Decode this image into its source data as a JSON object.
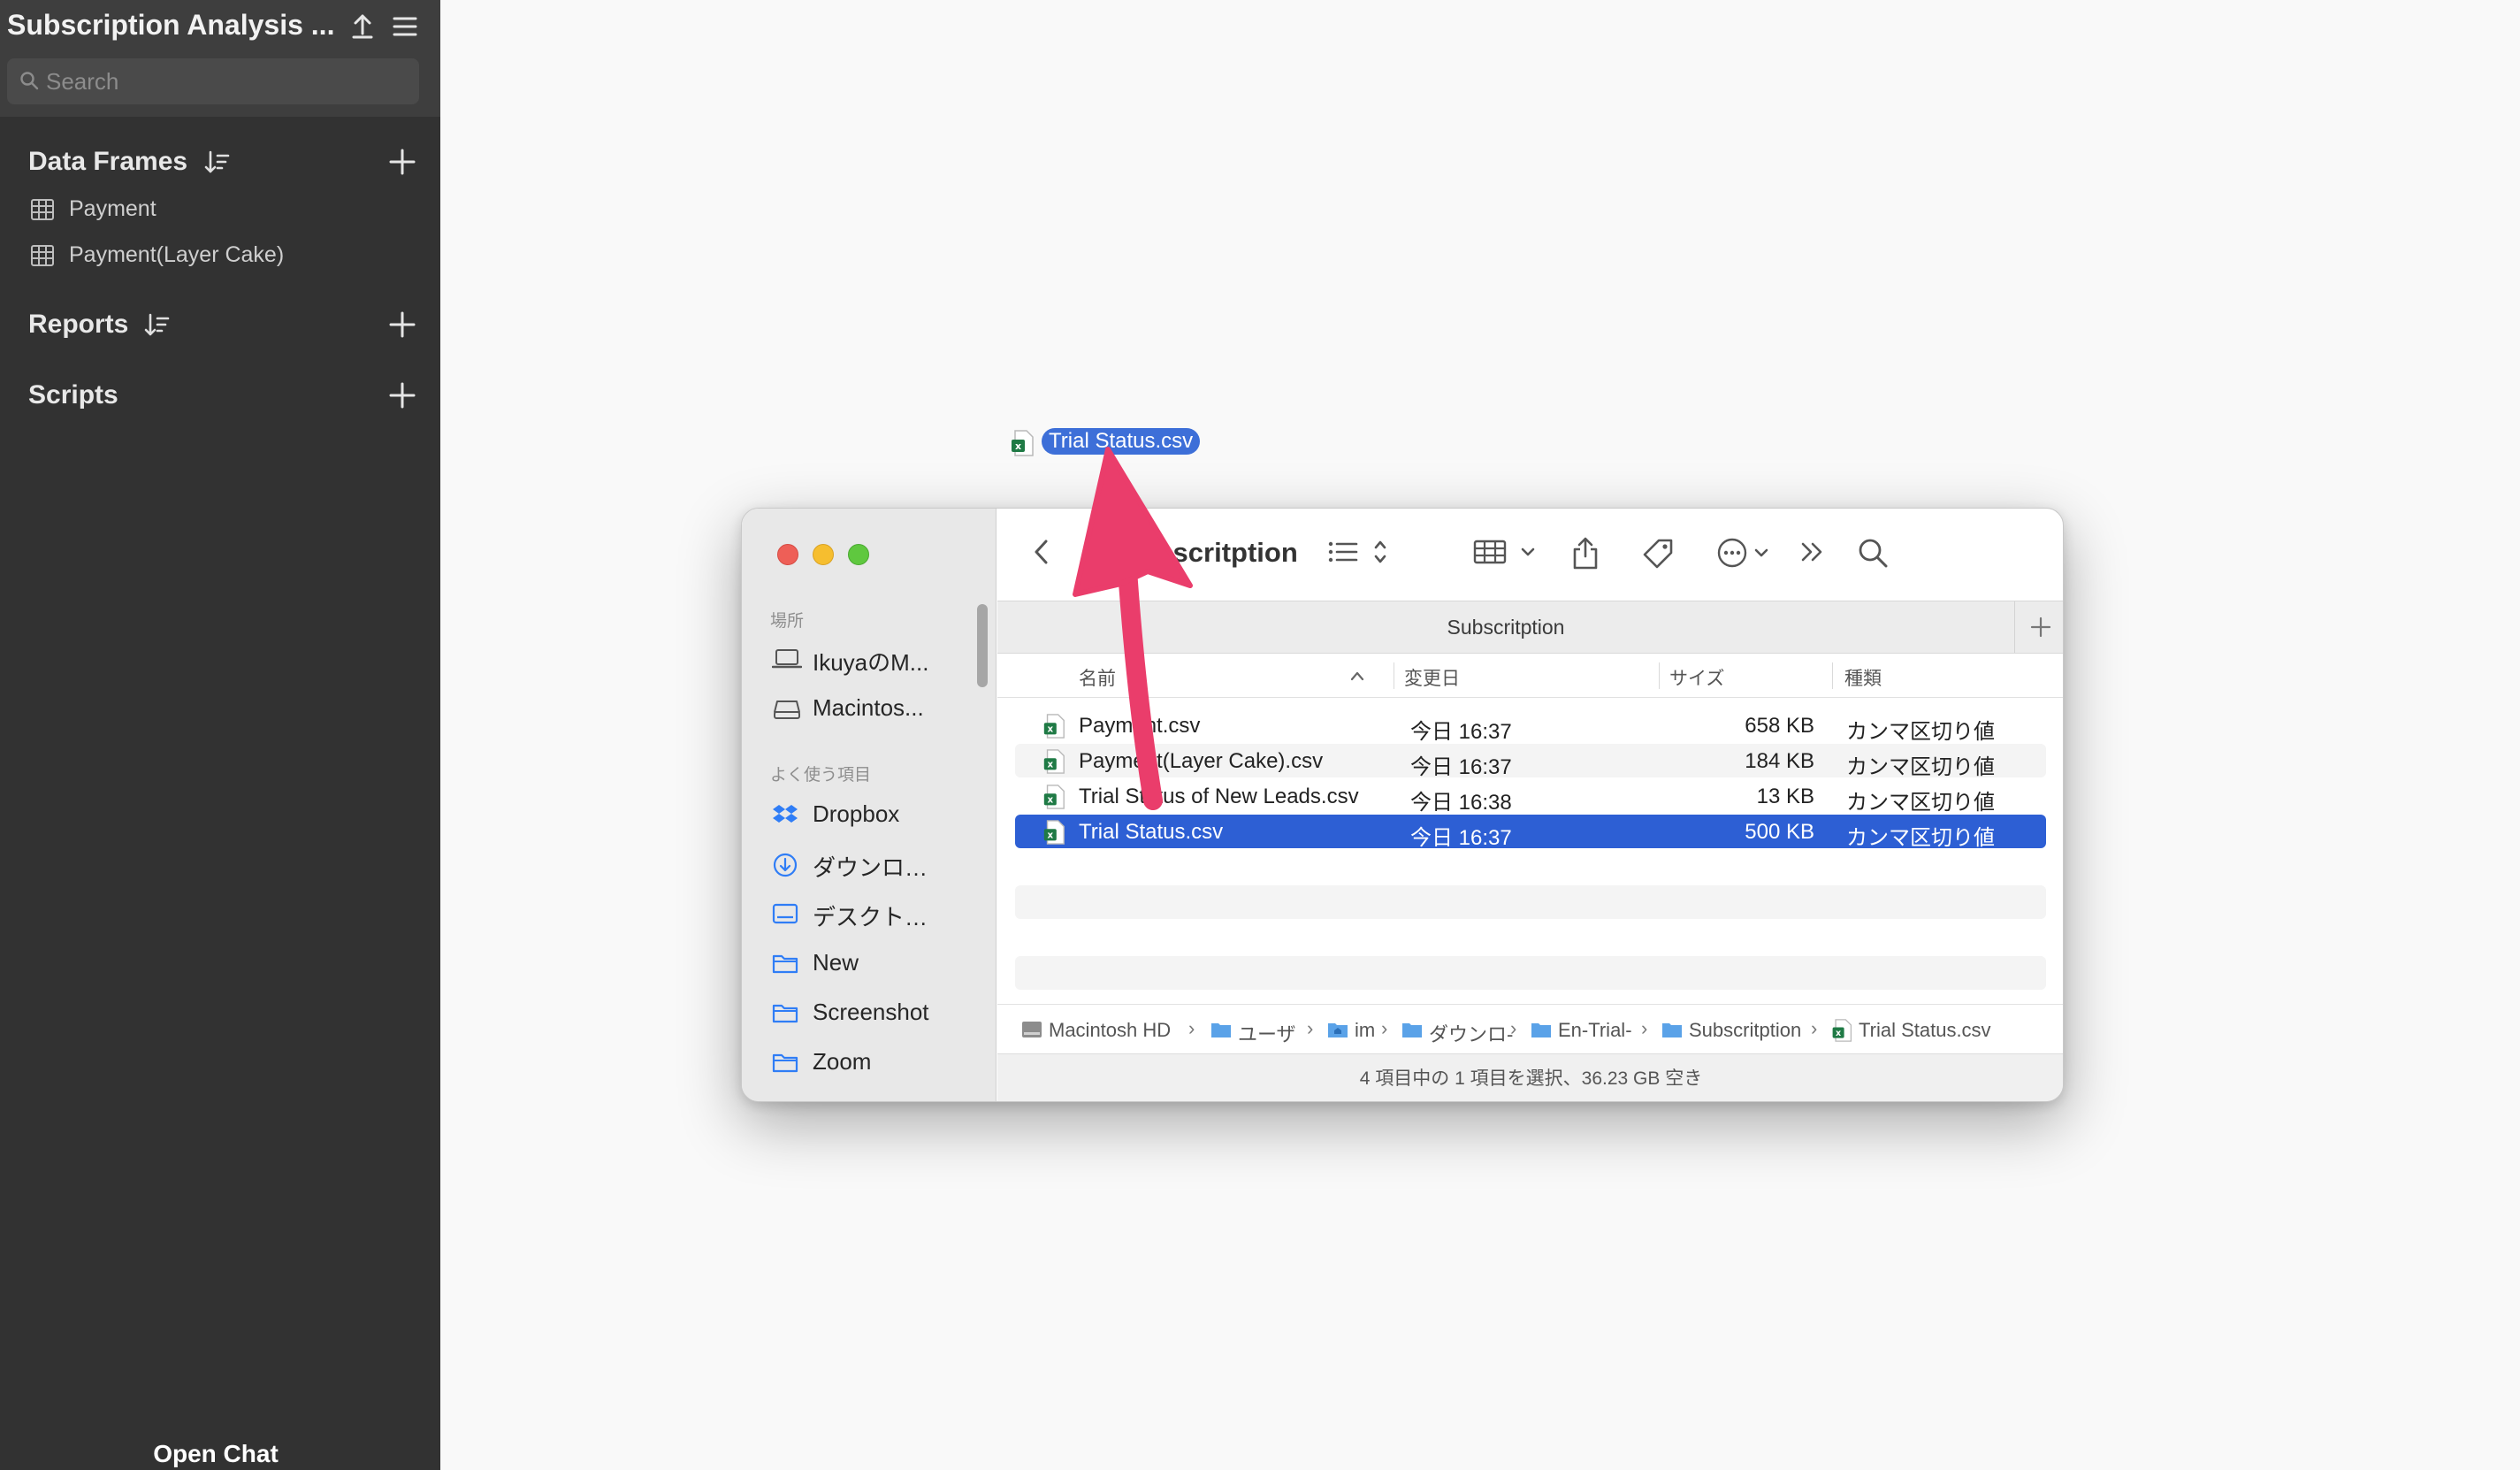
{
  "app": {
    "title": "Subscription Analysis ...",
    "search_placeholder": "Search",
    "sections": {
      "data_frames": "Data Frames",
      "reports": "Reports",
      "scripts": "Scripts"
    },
    "data_frames": [
      {
        "label": "Payment"
      },
      {
        "label": "Payment(Layer Cake)"
      }
    ],
    "open_chat": "Open Chat"
  },
  "drag": {
    "filename": "Trial Status.csv"
  },
  "finder": {
    "title": "Subscritption",
    "tab_label": "Subscritption",
    "sidebar": {
      "group_locations": "場所",
      "group_favorites": "よく使う項目",
      "locations": [
        {
          "label": "IkuyaのM...",
          "icon": "laptop-icon"
        },
        {
          "label": "Macintos...",
          "icon": "drive-icon"
        }
      ],
      "favorites": [
        {
          "label": "Dropbox",
          "icon": "dropbox-icon"
        },
        {
          "label": "ダウンロ…",
          "icon": "download-icon"
        },
        {
          "label": "デスクト…",
          "icon": "desktop-icon"
        },
        {
          "label": "New",
          "icon": "folder-icon"
        },
        {
          "label": "Screenshot",
          "icon": "folder-icon"
        },
        {
          "label": "Zoom",
          "icon": "folder-icon"
        }
      ]
    },
    "columns": {
      "name": "名前",
      "date": "変更日",
      "size": "サイズ",
      "kind": "種類"
    },
    "files": [
      {
        "name": "Payment.csv",
        "date": "今日 16:37",
        "size": "658 KB",
        "kind": "カンマ区切り値",
        "selected": false
      },
      {
        "name": "Payment(Layer Cake).csv",
        "date": "今日 16:37",
        "size": "184 KB",
        "kind": "カンマ区切り値",
        "selected": false
      },
      {
        "name": "Trial Status of New Leads.csv",
        "date": "今日 16:38",
        "size": "13 KB",
        "kind": "カンマ区切り値",
        "selected": false
      },
      {
        "name": "Trial Status.csv",
        "date": "今日 16:37",
        "size": "500 KB",
        "kind": "カンマ区切り値",
        "selected": true
      }
    ],
    "path": [
      {
        "label": "Macintosh HD",
        "icon": "hard-drive-icon"
      },
      {
        "label": "ユーザ",
        "icon": "folder-icon"
      },
      {
        "label": "im",
        "icon": "home-folder-icon"
      },
      {
        "label": "ダウンロ-",
        "icon": "folder-icon"
      },
      {
        "label": "En-Trial-",
        "icon": "folder-icon"
      },
      {
        "label": "Subscritption",
        "icon": "folder-icon"
      },
      {
        "label": "Trial Status.csv",
        "icon": "csv-file-icon"
      }
    ],
    "status": "4 項目中の 1 項目を選択、36.23 GB 空き"
  },
  "colors": {
    "sidebar_bg": "#323232",
    "selection_blue": "#2d5fd4",
    "arrow_pink": "#ea3d6b"
  }
}
